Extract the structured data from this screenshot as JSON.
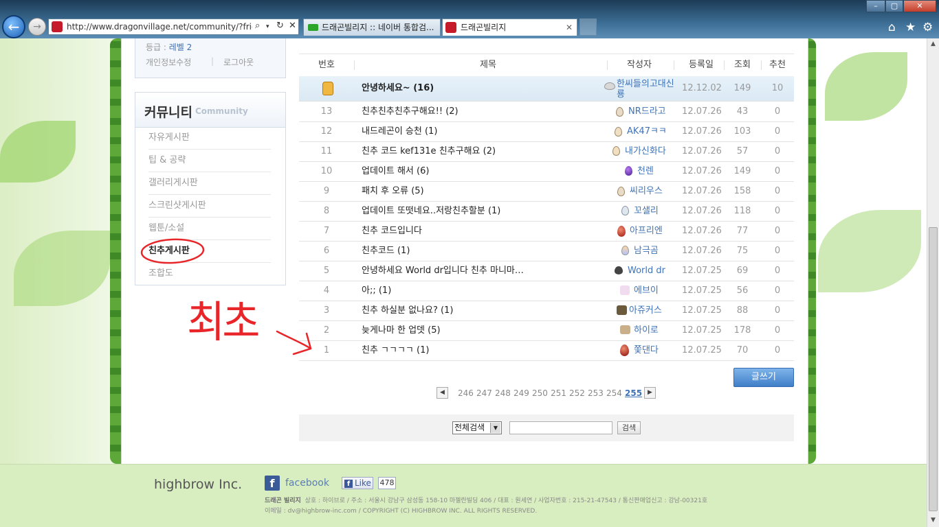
{
  "browser": {
    "url": "http://www.dragonvillage.net/community/?friends",
    "tabs": [
      {
        "label": "드래곤빌리지 :: 네이버 통합검..."
      },
      {
        "label": "드래곤빌리지"
      }
    ]
  },
  "login": {
    "level_label": "등급 : ",
    "level_value": "레벨 2",
    "edit_profile": "개인정보수정",
    "logout": "로그아웃"
  },
  "community": {
    "title": "커뮤니티",
    "subtitle": "Community",
    "menu": [
      {
        "label": "자유게시판"
      },
      {
        "label": "팁 & 공략"
      },
      {
        "label": "갤러리게시판"
      },
      {
        "label": "스크린샷게시판"
      },
      {
        "label": "웹툰/소설"
      },
      {
        "label": "친추게시판"
      },
      {
        "label": "조합도"
      }
    ]
  },
  "board": {
    "columns": {
      "no": "번호",
      "title": "제목",
      "author": "작성자",
      "date": "등록일",
      "views": "조회",
      "recommend": "추천"
    },
    "notice": {
      "title": "안녕하세요~ (16)",
      "author": "한씨들의고대신룡",
      "date": "12.12.02",
      "views": "149",
      "recommend": "10"
    },
    "rows": [
      {
        "no": "13",
        "title": "친추친추친추구해요!! (2)",
        "author": "NR드라고",
        "date": "12.07.26",
        "views": "43",
        "recommend": "0"
      },
      {
        "no": "12",
        "title": "내드레곤이 승천 (1)",
        "author": "AK47ㅋㅋ",
        "date": "12.07.26",
        "views": "103",
        "recommend": "0"
      },
      {
        "no": "11",
        "title": "친추 코드 kef131e 친추구해요 (2)",
        "author": "내가신화다",
        "date": "12.07.26",
        "views": "57",
        "recommend": "0"
      },
      {
        "no": "10",
        "title": "업데이트 해서 (6)",
        "author": "천렌",
        "date": "12.07.26",
        "views": "149",
        "recommend": "0"
      },
      {
        "no": "9",
        "title": "패치 후 오류 (5)",
        "author": "씨리우스",
        "date": "12.07.26",
        "views": "158",
        "recommend": "0"
      },
      {
        "no": "8",
        "title": "업데이트 또떳네요..저랑친추할분 (1)",
        "author": "꼬샐리",
        "date": "12.07.26",
        "views": "118",
        "recommend": "0"
      },
      {
        "no": "7",
        "title": "친추 코드입니다",
        "author": "아프리엔",
        "date": "12.07.26",
        "views": "77",
        "recommend": "0"
      },
      {
        "no": "6",
        "title": "친추코드 (1)",
        "author": "남극곰",
        "date": "12.07.26",
        "views": "75",
        "recommend": "0"
      },
      {
        "no": "5",
        "title": "안녕하세요 World dr입니다 친추 마니마…",
        "author": "World dr",
        "date": "12.07.25",
        "views": "69",
        "recommend": "0"
      },
      {
        "no": "4",
        "title": "아;; (1)",
        "author": "에브이",
        "date": "12.07.25",
        "views": "56",
        "recommend": "0"
      },
      {
        "no": "3",
        "title": "친추 하실분 없나요? (1)",
        "author": "아쥬커스",
        "date": "12.07.25",
        "views": "88",
        "recommend": "0"
      },
      {
        "no": "2",
        "title": "늦게나마 한 업뎃 (5)",
        "author": "하이로",
        "date": "12.07.25",
        "views": "178",
        "recommend": "0"
      },
      {
        "no": "1",
        "title": "친추 ㄱㄱㄱㄱ (1)",
        "author": "쫓댄다",
        "date": "12.07.25",
        "views": "70",
        "recommend": "0"
      }
    ],
    "write_button": "글쓰기",
    "pages": [
      "246",
      "247",
      "248",
      "249",
      "250",
      "251",
      "252",
      "253",
      "254",
      "255"
    ],
    "current_page": "255"
  },
  "search": {
    "scope": "전체검색",
    "button": "검색"
  },
  "footer": {
    "company": "highbrow Inc.",
    "facebook": "facebook",
    "like_label": "Like",
    "like_count": "478",
    "brand": "드래곤 빌리지",
    "info_line": "상호 : 하이브로  /  주소 : 서울시 강남구 삼성동 158-10 마젤란빌딩 406  /  대표 : 원세연  /  사업자번호 : 215-21-47543  /  통신판매업신고 : 강남-00321호",
    "contact_line": "이메일 : dv@highbrow-inc.com  /  COPYRIGHT (C) HIGHBROW INC. ALL RIGHTS RESERVED."
  },
  "annotation": {
    "text": "최초"
  },
  "colors": {
    "accent": "#3f73b7",
    "annotation": "#e8262a",
    "footer_bg": "#d8eec0"
  }
}
